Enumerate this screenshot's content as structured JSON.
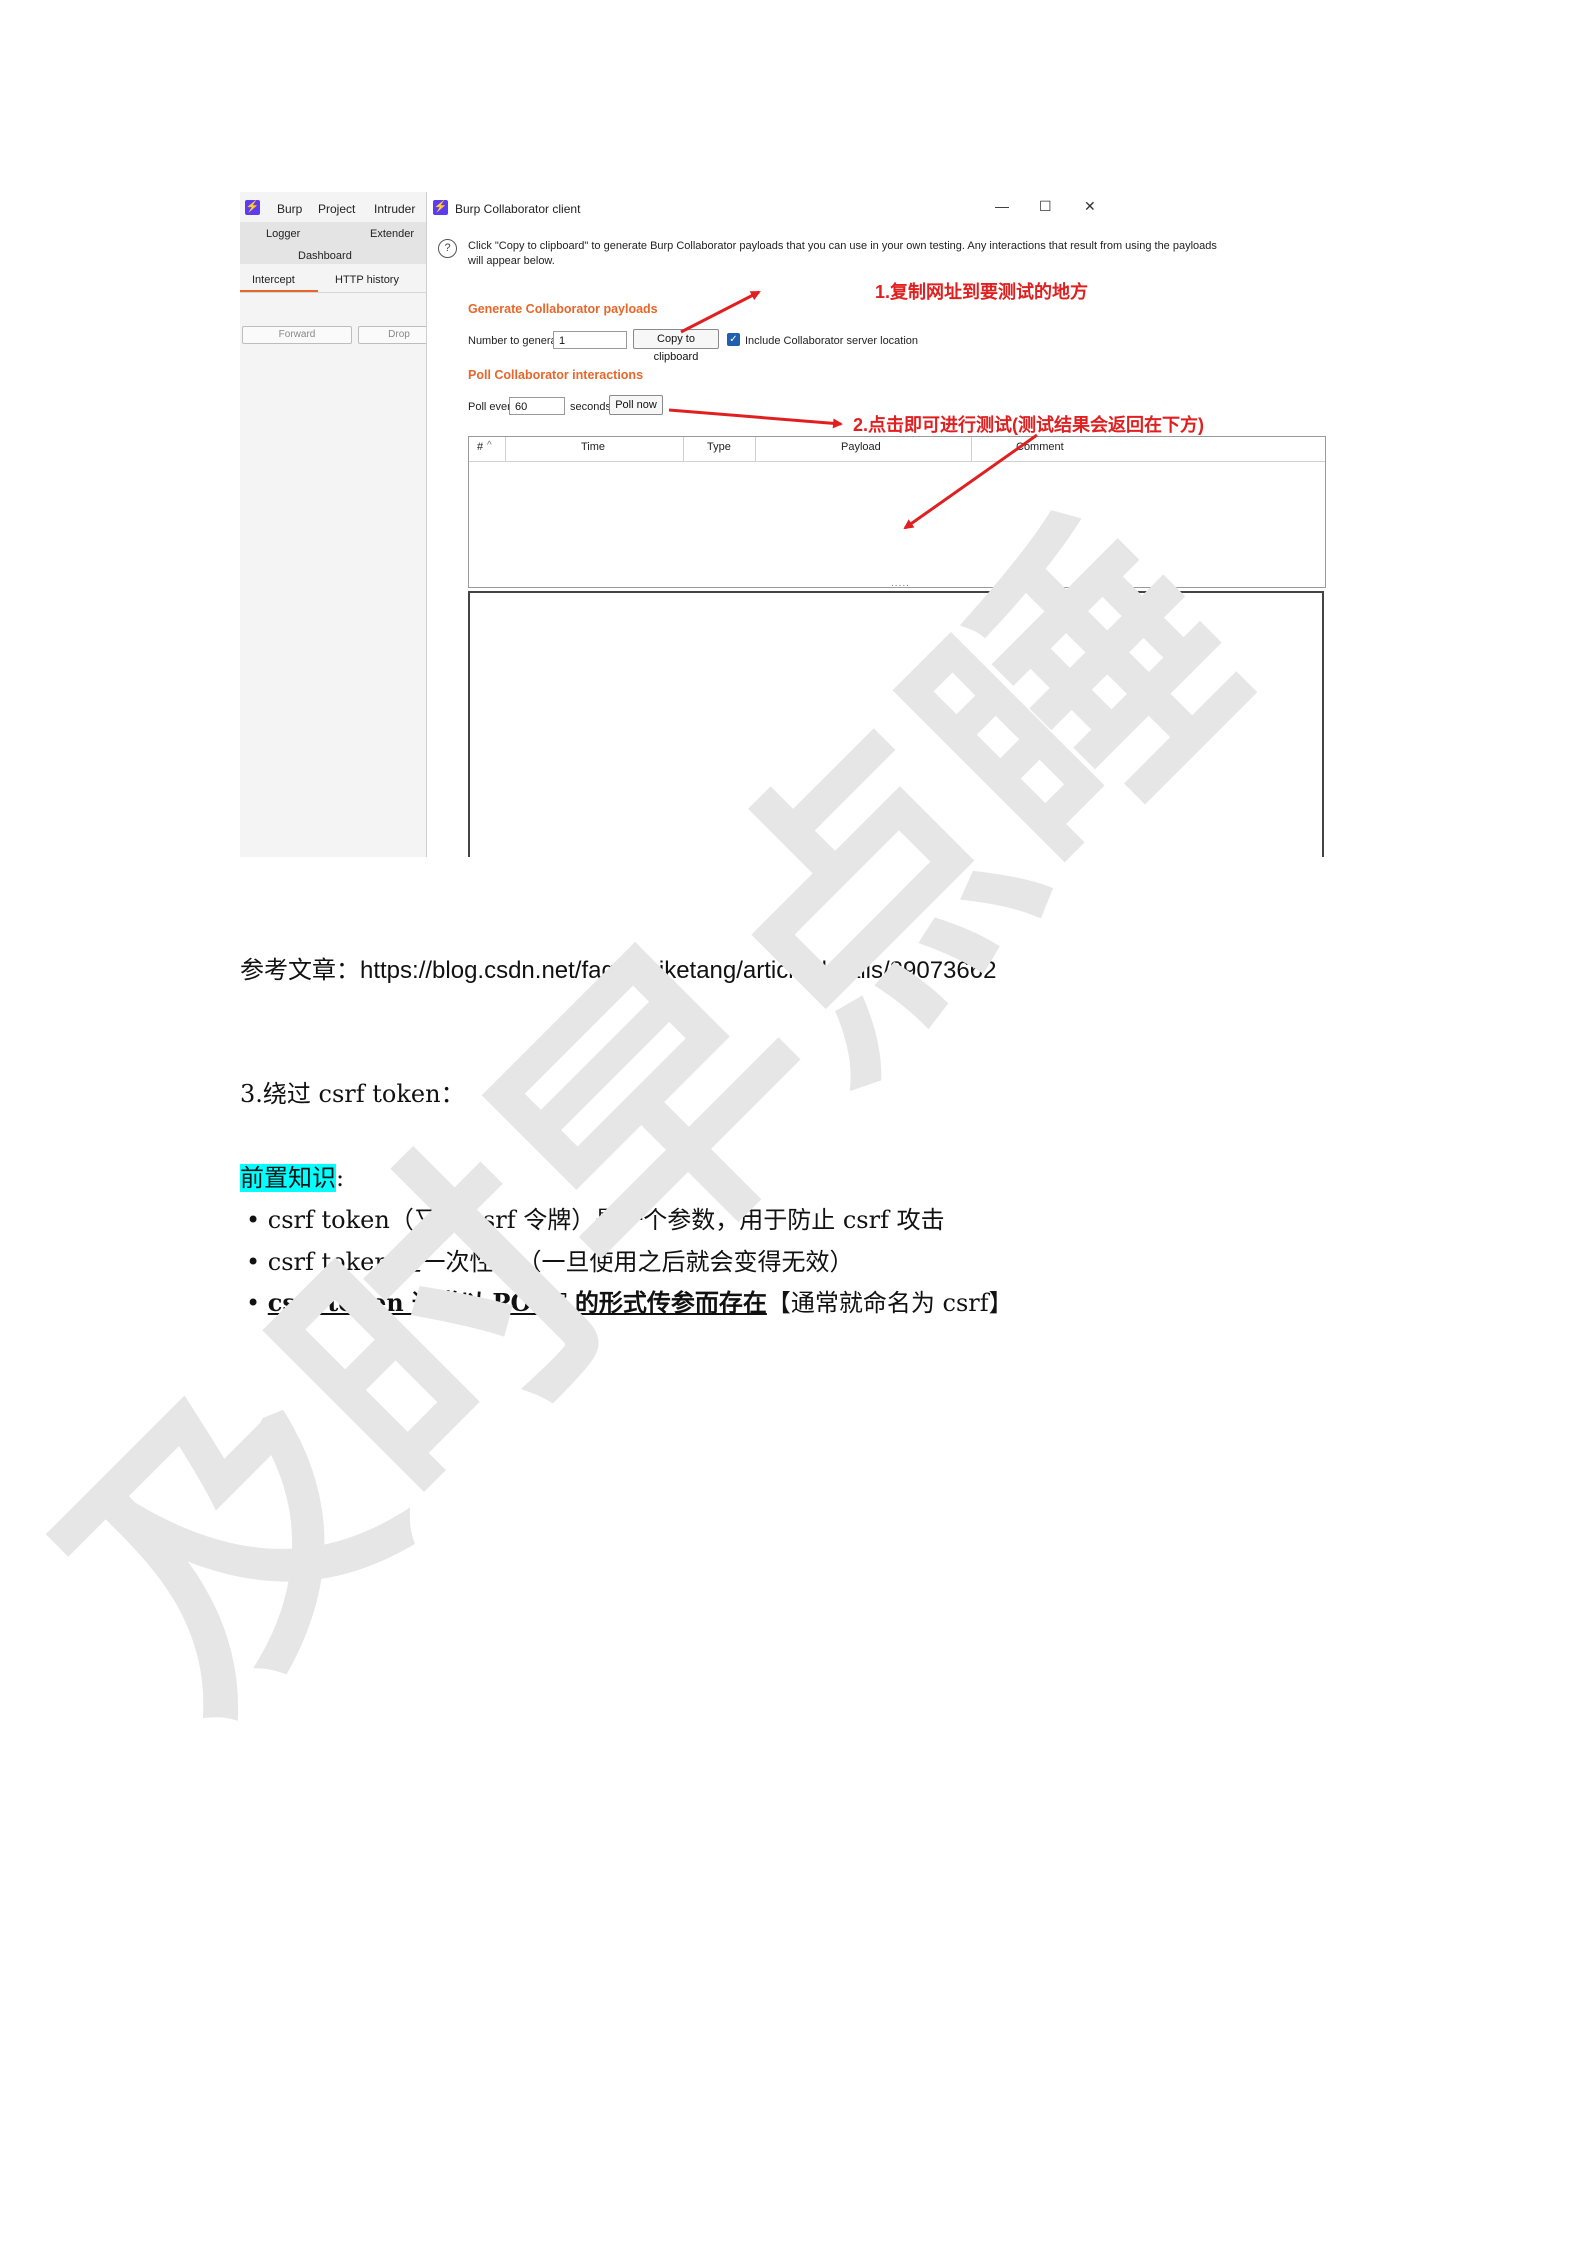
{
  "screenshot": {
    "burp": {
      "menu": [
        "Burp",
        "Project",
        "Intruder"
      ],
      "tabs_row1": [
        "Logger",
        "Extender"
      ],
      "tabs_row2": "Dashboard",
      "subtabs": [
        "Intercept",
        "HTTP history"
      ],
      "buttons": [
        "Forward",
        "Drop"
      ]
    },
    "collab": {
      "title": "Burp Collaborator client",
      "window_controls": [
        "—",
        "☐",
        "✕"
      ],
      "help_icon": "?",
      "help_line1": "Click \"Copy to clipboard\" to generate Burp Collaborator payloads that you can use in your own testing. Any interactions that result from using the payloads",
      "help_line2": "will appear below.",
      "generate_heading": "Generate Collaborator payloads",
      "number_label": "Number to generate:",
      "number_value": "1",
      "copy_button": "Copy to clipboard",
      "include_label": "Include Collaborator server location",
      "include_checked": true,
      "poll_heading": "Poll Collaborator interactions",
      "poll_every_label": "Poll every",
      "poll_value": "60",
      "seconds_label": "seconds",
      "poll_now_button": "Poll now",
      "table_headers": [
        "#",
        "Time",
        "Type",
        "Payload",
        "Comment"
      ],
      "splitter": "....."
    },
    "annotations": {
      "step1": "1.复制网址到要测试的地方",
      "step2": "2.点击即可进行测试(测试结果会返回在下方)",
      "arrow_color": "#e02020"
    }
  },
  "doc": {
    "reference_label": "参考文章：",
    "reference_url": "https://blog.csdn.net/fageweiketang/article/details/89073662",
    "section_title": "3.绕过 csrf  token：",
    "prereq_label": "前置知识",
    "prereq_colon": ":",
    "bullets": [
      "csrf  token（又称 csrf  令牌）是一个参数，用于防止 csrf 攻击",
      "csrf  token 是一次性的（一旦使用之后就会变得无效）"
    ],
    "bullet3_bold": "csrf  token 通常以 POST 的形式传参而存在",
    "bullet3_rest": "【通常就命名为 csrf】",
    "bullet_mark": "•"
  },
  "watermark": {
    "text": "及时早点睡",
    "color": "#e6e6e6"
  }
}
